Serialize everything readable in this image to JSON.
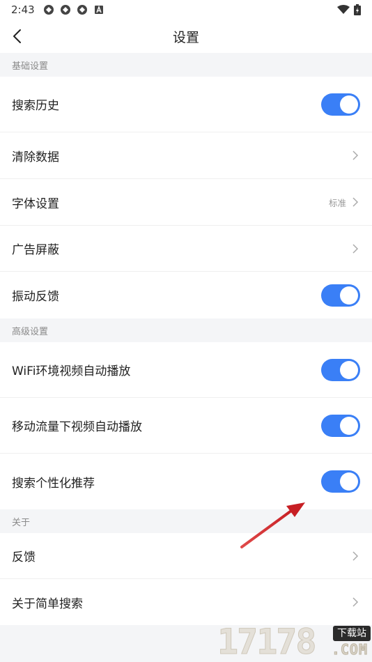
{
  "status_bar": {
    "time": "2:43",
    "notification_icons": [
      "app-icon",
      "app-icon",
      "app-icon",
      "a-badge-icon"
    ],
    "right_icons": [
      "wifi-icon",
      "battery-icon"
    ]
  },
  "header": {
    "title": "设置",
    "back_icon": "back-arrow-icon"
  },
  "sections": [
    {
      "label": "基础设置",
      "items": [
        {
          "label": "搜索历史",
          "control": "toggle",
          "on": true
        },
        {
          "label": "清除数据",
          "control": "chevron"
        },
        {
          "label": "字体设置",
          "control": "chevron",
          "value": "标准"
        },
        {
          "label": "广告屏蔽",
          "control": "chevron"
        },
        {
          "label": "振动反馈",
          "control": "toggle",
          "on": true
        }
      ]
    },
    {
      "label": "高级设置",
      "items": [
        {
          "label": "WiFi环境视频自动播放",
          "control": "toggle",
          "on": true
        },
        {
          "label": "移动流量下视频自动播放",
          "control": "toggle",
          "on": true
        },
        {
          "label": "搜索个性化推荐",
          "control": "toggle",
          "on": true
        }
      ]
    },
    {
      "label": "关于",
      "items": [
        {
          "label": "反馈",
          "control": "chevron"
        },
        {
          "label": "关于简单搜索",
          "control": "chevron"
        }
      ]
    }
  ],
  "watermark": {
    "number": "17178",
    "badge": "下载站",
    "domain": ".COM"
  },
  "colors": {
    "toggle_on": "#3a7ff6",
    "annotation_arrow": "#d9262a"
  }
}
